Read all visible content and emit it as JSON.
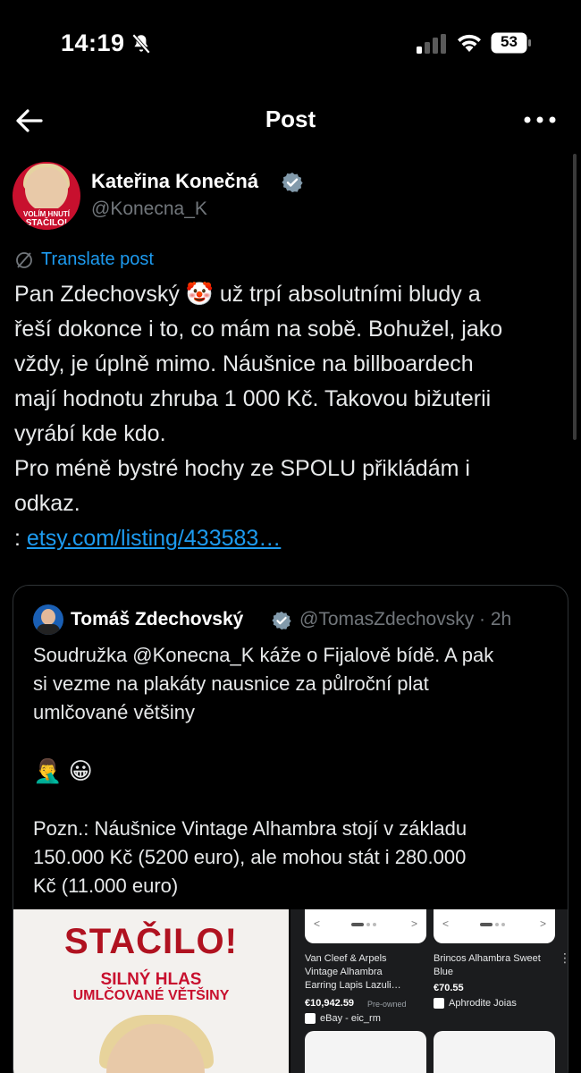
{
  "status_bar": {
    "time": "14:19",
    "battery": "53"
  },
  "nav": {
    "title": "Post"
  },
  "author": {
    "name": "Kateřina Konečná",
    "handle": "@Konecna_K",
    "avatar_badge_line1": "VOLÍM HNUTÍ",
    "avatar_badge_line2": "STAČILO!"
  },
  "translate_label": "Translate post",
  "post": {
    "lines": [
      "Pan Zdechovský 🤡 už trpí absolutními bludy a",
      "řeší dokonce i to, co mám na sobě. Bohužel, jako",
      "vždy, je úplně mimo. Náušnice na billboardech",
      "mají hodnotu zhruba 1 000 Kč. Takovou bižuterii",
      "vyrábí kde kdo.",
      "Pro méně bystré hochy ze SPOLU přikládám i",
      "odkaz."
    ],
    "link_prefix": ": ",
    "link_text": "etsy.com/listing/433583…"
  },
  "quote": {
    "name": "Tomáš Zdechovský",
    "handle_time": "@TomasZdechovsky · 2h",
    "lines": [
      "Soudružka @Konecna_K káže o Fijalově bídě. A pak",
      "si vezme na plakáty nausnice za půlroční plat",
      "umlčované většiny"
    ],
    "emoji": "🤦‍♂️ 😀",
    "lines2": [
      "Pozn.: Náušnice Vintage Alhambra stojí v základu",
      "150.000 Kč (5200 euro), ale mohou stát i 280.000",
      "Kč (11.000 euro)"
    ],
    "poster": {
      "title": "STAČILO!",
      "sub1": "SILNÝ HLAS",
      "sub2": "UMLČOVANÉ VĚTŠINY"
    },
    "products": [
      {
        "title_line1": "Van Cleef & Arpels",
        "title_line2": "Vintage Alhambra",
        "title_line3": "Earring Lapis Lazuli…",
        "price": "€10,942.59",
        "condition": "Pre-owned",
        "seller": "eBay - eic_rm"
      },
      {
        "title_line1": "Brincos Alhambra Sweet",
        "title_line2": "Blue",
        "price": "€70.55",
        "seller": "Aphrodite Joias"
      }
    ]
  }
}
